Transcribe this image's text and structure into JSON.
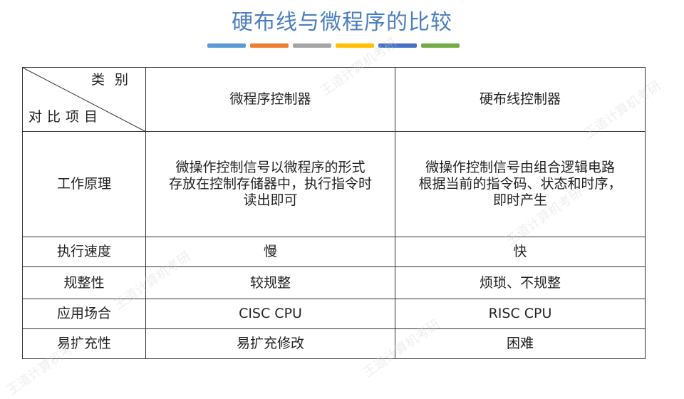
{
  "title": "硬布线与微程序的比较",
  "accent_colors": [
    "#5b9bd5",
    "#ed7d31",
    "#a5a5a5",
    "#ffc000",
    "#4472c4",
    "#70ad47"
  ],
  "table": {
    "corner_top": "类别",
    "corner_bottom": "对比项目",
    "columns": [
      "微程序控制器",
      "硬布线控制器"
    ],
    "rows": [
      {
        "label": "工作原理",
        "micro": "微操作控制信号以微程序的形式\n存放在控制存储器中，执行指令时\n读出即可",
        "hard": "微操作控制信号由组合逻辑电路\n根据当前的指令码、状态和时序，\n即时产生"
      },
      {
        "label": "执行速度",
        "micro": "慢",
        "hard": "快"
      },
      {
        "label": "规整性",
        "micro": "较规整",
        "hard": "烦琐、不规整"
      },
      {
        "label": "应用场合",
        "micro": "CISC CPU",
        "hard": "RISC CPU"
      },
      {
        "label": "易扩充性",
        "micro": "易扩充修改",
        "hard": "困难"
      }
    ]
  },
  "watermark_text": "王道计算机考研"
}
